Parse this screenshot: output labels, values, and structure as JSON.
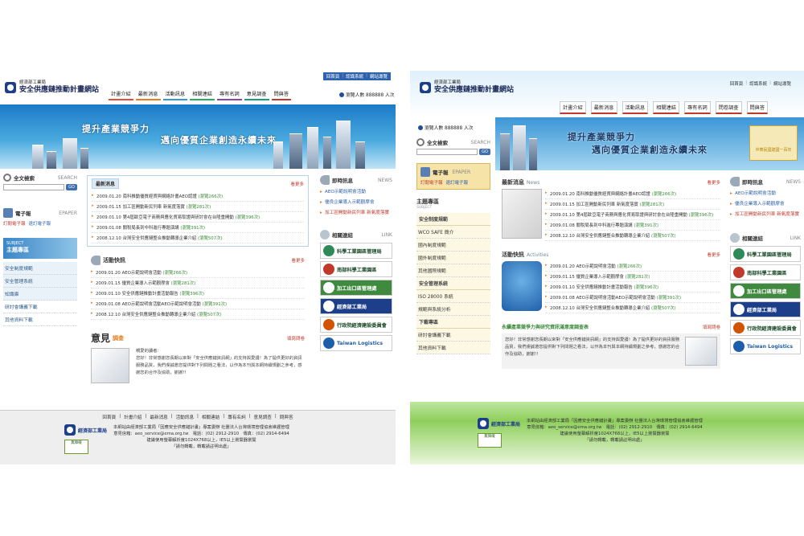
{
  "site": {
    "ministry": "經濟部工業局",
    "title": "安全供應鏈推動計畫網站"
  },
  "top_links": [
    "回首頁",
    "認識系統",
    "網站導覽"
  ],
  "nav": [
    "計畫介紹",
    "最新消息",
    "活動訊息",
    "相關連結",
    "專有名詞",
    "意見調查",
    "問與答"
  ],
  "nav_right": [
    "計畫介紹",
    "最新消息",
    "活動訊息",
    "相關連結",
    "專有名詞",
    "問卷調查",
    "問與答"
  ],
  "counter": "瀏覽人數 888888 人次",
  "banner": {
    "slogan1": "提升產業競爭力",
    "slogan2": "邁向優質企業創造永續未來",
    "badge": "中華民國建國一百年"
  },
  "search": {
    "title": "全文檢索",
    "title_en": "SEARCH",
    "button": "GO"
  },
  "epaper": {
    "title": "電子報",
    "title_en": "EPAPER",
    "subscribe": "訂閱電子報",
    "unsubscribe": "退訂電子報"
  },
  "subject": {
    "title": "主題專區",
    "title_en": "SUBJECT"
  },
  "subject_left": [
    "安全制度規範",
    "安全管理系統",
    "知識庫",
    "研討會講義下載",
    "其他資料下載"
  ],
  "subject_right": {
    "groups": [
      {
        "title": "安全制度規範",
        "items": [
          "WCO SAFE 簡介",
          "國內制度規範",
          "國外制度規範",
          "其他國際規範"
        ]
      },
      {
        "title": "安全管理系統",
        "items": [
          "ISO 28000 系統",
          "規範與系統分析"
        ]
      },
      {
        "title": "下載專區",
        "items": [
          "研討會講義下載",
          "其他資料下載"
        ]
      }
    ]
  },
  "news": {
    "tab": "最新消息",
    "title": "最新消息",
    "title_en": "News",
    "more": "看更多",
    "items": [
      {
        "date": "2009.01.20",
        "text": "南科推動優質經貿與網絡計畫AEO認證",
        "views": "(瀏覽266次)"
      },
      {
        "date": "2009.01.15",
        "text": "加工區開動新民列車 新氣度落實",
        "views": "(瀏覽281次)"
      },
      {
        "date": "2009.01.10",
        "text": "第4屆歐亞電子商務與應化貿易取證與研討會在台隆重開動",
        "views": "(瀏覽396次)"
      },
      {
        "date": "2009.01.08",
        "text": "關稅局長到中科進行專題演講",
        "views": "(瀏覽391次)"
      },
      {
        "date": "2008.12.10",
        "text": "台灣安全供應鏈整合推動轉導企業介紹",
        "views": "(瀏覽507次)"
      }
    ]
  },
  "activities": {
    "title": "活動快訊",
    "title_en": "Activities",
    "more": "看更多",
    "items": [
      {
        "date": "2009.01.20",
        "text": "AEO示範說明會活動",
        "views": "(瀏覽266次)"
      },
      {
        "date": "2009.01.15",
        "text": "優質企業導入示範觀摩會",
        "views": "(瀏覽281次)"
      },
      {
        "date": "2009.01.10",
        "text": "安全供應鏈推動計畫活動報告",
        "views": "(瀏覽396次)"
      },
      {
        "date": "2009.01.08",
        "text": "AEO示範說明會活動AEO示範說明會活動",
        "views": "(瀏覽391次)"
      },
      {
        "date": "2008.12.10",
        "text": "台灣安全供應鏈整合推動轉導企業介紹",
        "views": "(瀏覽507次)"
      }
    ]
  },
  "hot": {
    "title": "即時訊息",
    "title_en": "NEWS",
    "items": [
      "AEO示範說明會活動",
      "優良企業導入示範觀摩會",
      "加工區開動新民列車 新氣度落實"
    ]
  },
  "links": {
    "title": "相關連結",
    "title_en": "LINK",
    "items": [
      "科學工業園區管理局",
      "南部科學工業園區",
      "加工出口區管理處",
      "經濟部工業局",
      "行政院經濟建設委員會",
      "Taiwan Logistics"
    ]
  },
  "survey": {
    "title_main": "意見",
    "title_sub": "調查",
    "more": "填寫問卷",
    "right_title": "永續產業競爭力與研究資訊滿意度調查表",
    "greeting": "親愛的讀者：",
    "text": "您好！非常感謝您長期以來對「安全供應鏈資訊網」的支持與愛護！為了提供更好的資訊服務品質，我們虔誠邀您提供對下列問題之看法，以作為本刊與本網持續規劃之參考，感謝您的合作及協助，謝謝!!"
  },
  "footer": {
    "links": [
      "回首頁",
      "計畫介紹",
      "最新消息",
      "活動訊息",
      "相關連結",
      "專有名詞",
      "意見調查",
      "問與答"
    ],
    "line1": "本網站由經濟部工業局「因應安全供應鏈計畫」專案委辦 社團法人台灣環境管理協會維護管理",
    "line2": "意見信箱：aeo_service@ema.org.tw　電話：(02) 2912-2910　傳真：(02) 2914-6494",
    "line3": "建議使用螢幕解析度1024X768以上，IE5以上瀏覽器瀏覽",
    "line4": "「請勿轉載，轉載請註明出處」",
    "logo": "經濟部工業局",
    "badge": "無障礙"
  }
}
